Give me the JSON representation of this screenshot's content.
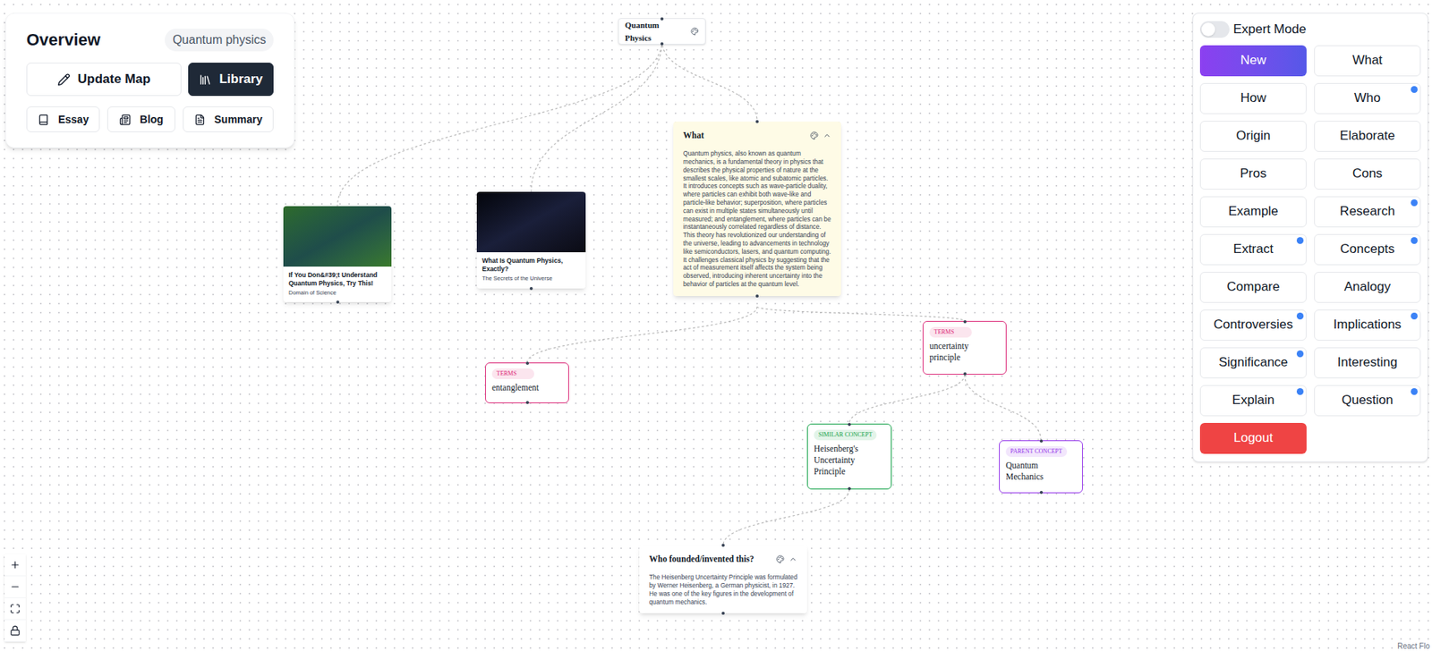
{
  "overview": {
    "title": "Overview",
    "topic": "Quantum physics",
    "actions": [
      {
        "label": "Update Map",
        "selected": false
      },
      {
        "label": "Library",
        "selected": true
      }
    ],
    "formats": [
      "Essay",
      "Blog",
      "Summary"
    ]
  },
  "canvas": {
    "nodes": [
      {
        "kind": "root",
        "title": "Quantum Physics"
      },
      {
        "kind": "video",
        "title": "If You Don&#39;t Understand Quantum Physics, Try This!",
        "channel": "Domain of Science"
      },
      {
        "kind": "video",
        "title": "What Is Quantum Physics, Exactly?",
        "channel": "The Secrets of the Universe"
      },
      {
        "kind": "answer",
        "title": "What",
        "text": "Quantum physics, also known as quantum mechanics, is a fundamental theory in physics that describes the physical properties of nature at the smallest scales, like atomic and subatomic particles. It introduces concepts such as wave-particle duality, where particles can exhibit both wave-like and particle-like behavior; superposition, where particles can exist in multiple states simultaneously until measured; and entanglement, where particles can be instantaneously correlated regardless of distance. This theory has revolutionized our understanding of the universe, leading to advancements in technology like semiconductors, lasers, and quantum computing. It challenges classical physics by suggesting that the act of measurement itself affects the system being observed, introducing inherent uncertainty into the behavior of particles at the quantum level.",
        "selected": true,
        "expanded": true
      },
      {
        "kind": "tag",
        "tag": "TERMS",
        "label": "entanglement",
        "color": "#db2777"
      },
      {
        "kind": "tag",
        "tag": "TERMS",
        "label": "uncertainty principle",
        "color": "#db2777"
      },
      {
        "kind": "tag",
        "tag": "SIMILAR CONCEPT",
        "label": "Heisenberg's Uncertainty Principle",
        "color": "#16a34a"
      },
      {
        "kind": "tag",
        "tag": "PARENT CONCEPT",
        "label": "Quantum Mechanics",
        "color": "#9333ea"
      },
      {
        "kind": "answer",
        "title": "Who founded/invented this?",
        "text": "The Heisenberg Uncertainty Principle was formulated by Werner Heisenberg, a German physicist, in 1927. He was one of the key figures in the development of quantum mechanics.",
        "selected": false,
        "expanded": true
      }
    ],
    "attribution": "React Flo"
  },
  "panel": {
    "expert_mode": {
      "label": "Expert Mode",
      "on": false
    },
    "buttons": [
      {
        "label": "New",
        "selected": true,
        "badge": false
      },
      {
        "label": "What",
        "selected": false,
        "badge": false
      },
      {
        "label": "How",
        "selected": false,
        "badge": false
      },
      {
        "label": "Who",
        "selected": false,
        "badge": true
      },
      {
        "label": "Origin",
        "selected": false,
        "badge": false
      },
      {
        "label": "Elaborate",
        "selected": false,
        "badge": false
      },
      {
        "label": "Pros",
        "selected": false,
        "badge": false
      },
      {
        "label": "Cons",
        "selected": false,
        "badge": false
      },
      {
        "label": "Example",
        "selected": false,
        "badge": false
      },
      {
        "label": "Research",
        "selected": false,
        "badge": true
      },
      {
        "label": "Extract",
        "selected": false,
        "badge": true
      },
      {
        "label": "Concepts",
        "selected": false,
        "badge": true
      },
      {
        "label": "Compare",
        "selected": false,
        "badge": false
      },
      {
        "label": "Analogy",
        "selected": false,
        "badge": false
      },
      {
        "label": "Controversies",
        "selected": false,
        "badge": true
      },
      {
        "label": "Implications",
        "selected": false,
        "badge": true
      },
      {
        "label": "Significance",
        "selected": false,
        "badge": true
      },
      {
        "label": "Interesting",
        "selected": false,
        "badge": false
      },
      {
        "label": "Explain",
        "selected": false,
        "badge": true
      },
      {
        "label": "Question",
        "selected": false,
        "badge": true
      }
    ],
    "logout": "Logout"
  }
}
